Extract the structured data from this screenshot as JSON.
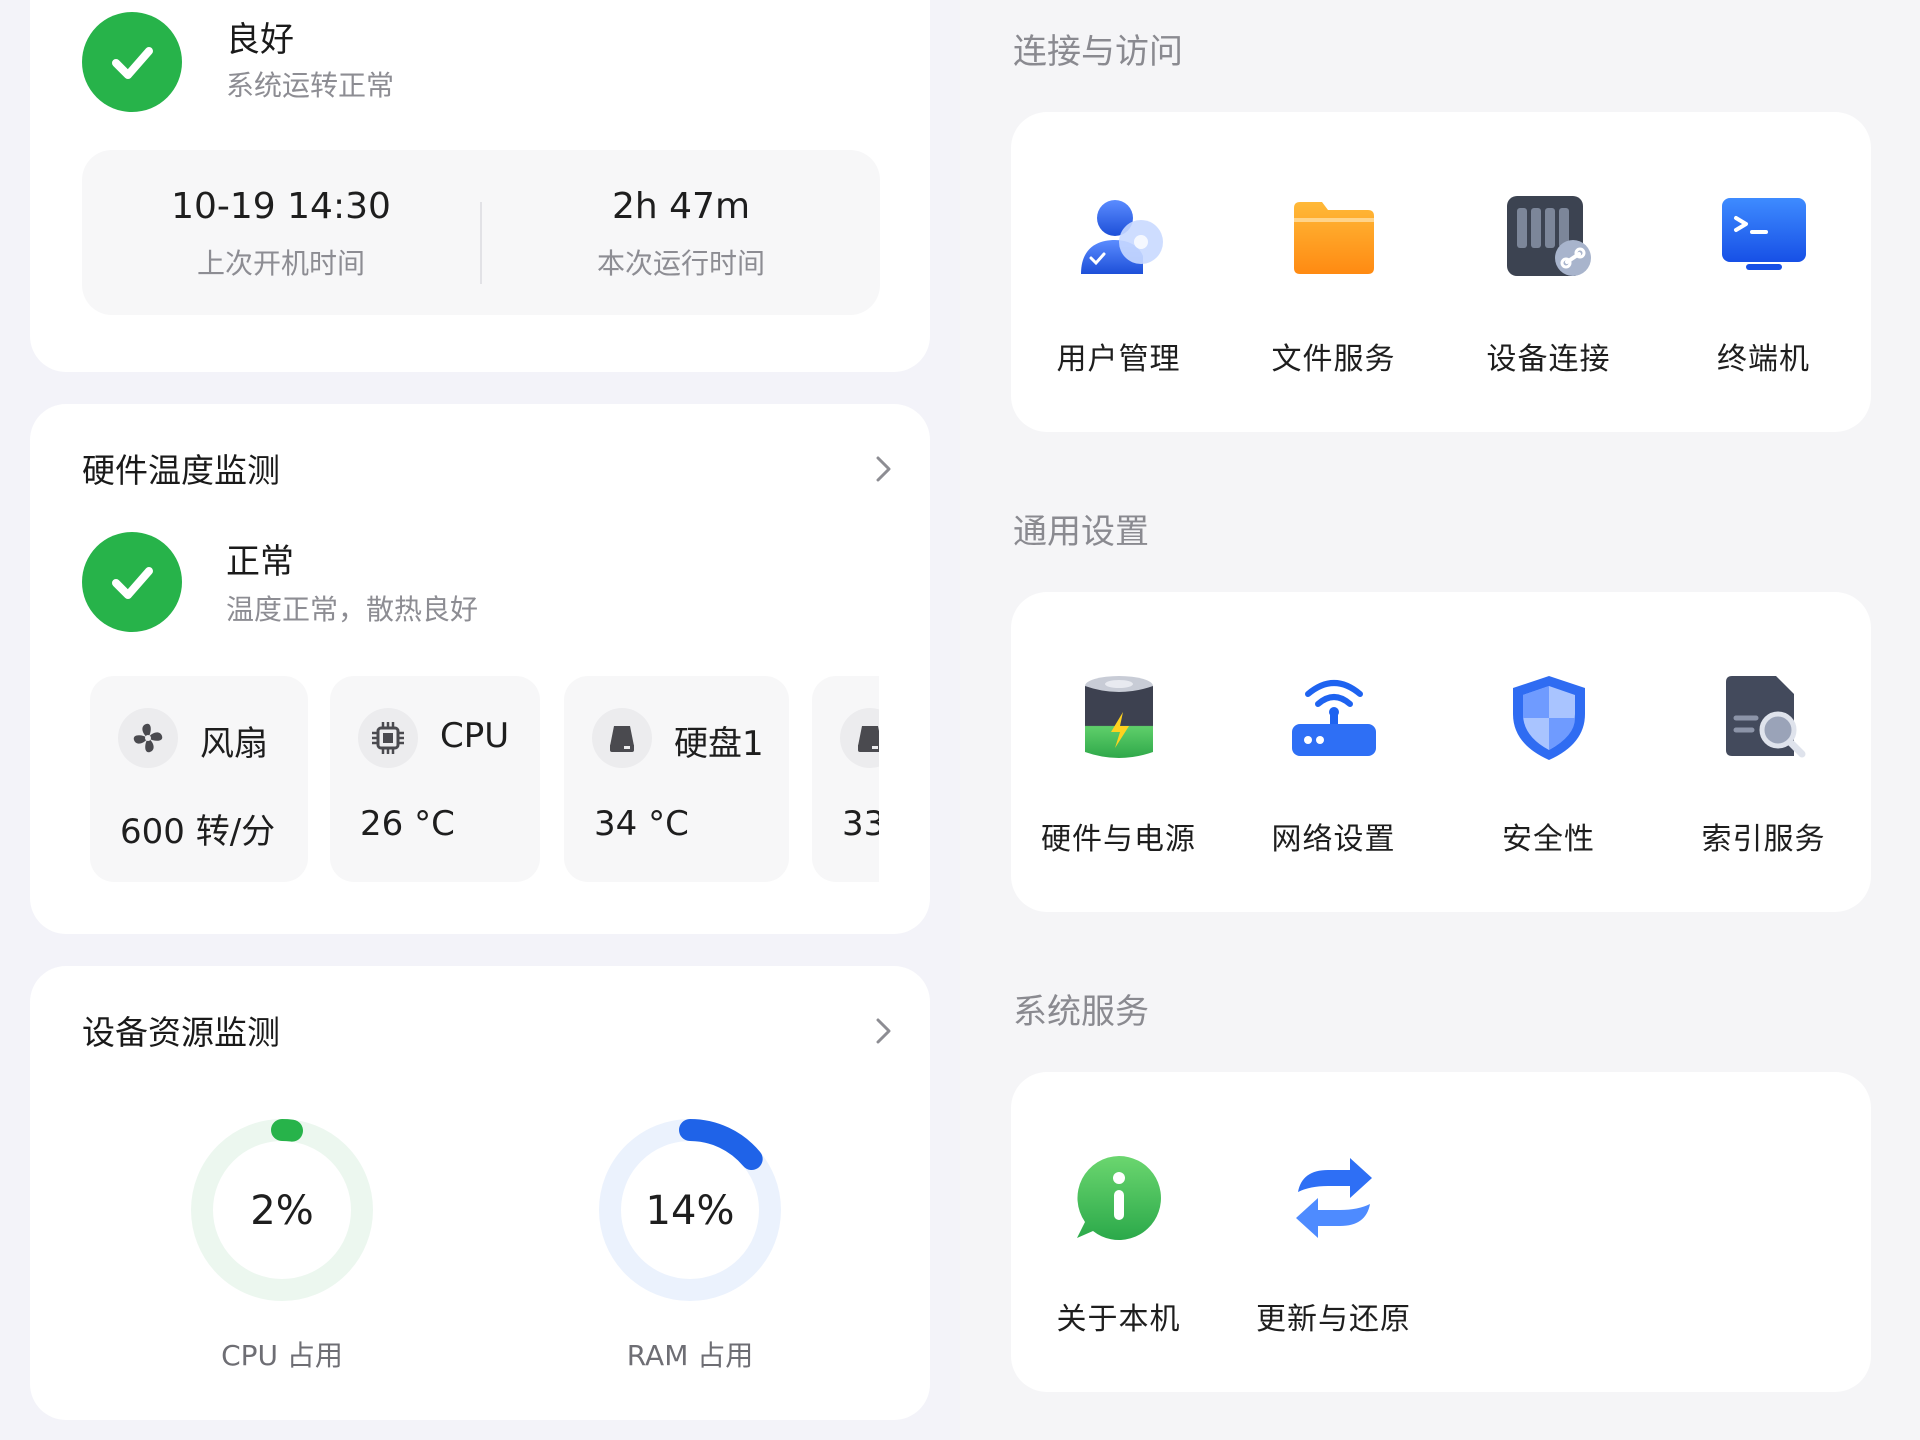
{
  "system_status": {
    "title": "良好",
    "subtitle": "系统运转正常",
    "last_boot_value": "10-19 14:30",
    "last_boot_label": "上次开机时间",
    "uptime_value": "2h 47m",
    "uptime_label": "本次运行时间"
  },
  "hardware": {
    "title": "硬件温度监测",
    "status_title": "正常",
    "status_subtitle": "温度正常，散热良好",
    "tiles": [
      {
        "name": "风扇",
        "value": "600 转/分",
        "icon": "fan-icon"
      },
      {
        "name": "CPU",
        "value": "26 °C",
        "icon": "cpu-chip-icon"
      },
      {
        "name": "硬盘1",
        "value": "34 °C",
        "icon": "disk-icon"
      },
      {
        "name": "",
        "value": "33",
        "icon": "disk-icon"
      }
    ]
  },
  "resources": {
    "title": "设备资源监测",
    "cpu": {
      "value": "2%",
      "label": "CPU 占用",
      "percent": 2,
      "color": "#27b34a"
    },
    "ram": {
      "value": "14%",
      "label": "RAM 占用",
      "percent": 14,
      "color": "#1f63e8"
    }
  },
  "sections": [
    {
      "title": "连接与访问",
      "items": [
        {
          "label": "用户管理",
          "icon": "user-management-icon"
        },
        {
          "label": "文件服务",
          "icon": "folder-icon"
        },
        {
          "label": "设备连接",
          "icon": "device-link-icon"
        },
        {
          "label": "终端机",
          "icon": "terminal-icon"
        }
      ]
    },
    {
      "title": "通用设置",
      "items": [
        {
          "label": "硬件与电源",
          "icon": "battery-icon"
        },
        {
          "label": "网络设置",
          "icon": "router-icon"
        },
        {
          "label": "安全性",
          "icon": "shield-icon"
        },
        {
          "label": "索引服务",
          "icon": "index-search-icon"
        }
      ]
    },
    {
      "title": "系统服务",
      "items": [
        {
          "label": "关于本机",
          "icon": "info-icon"
        },
        {
          "label": "更新与还原",
          "icon": "refresh-icon"
        }
      ]
    }
  ],
  "colors": {
    "ok_green": "#27b34a",
    "accent_blue": "#1f63e8",
    "folder_orange": "#ff9a1f"
  }
}
